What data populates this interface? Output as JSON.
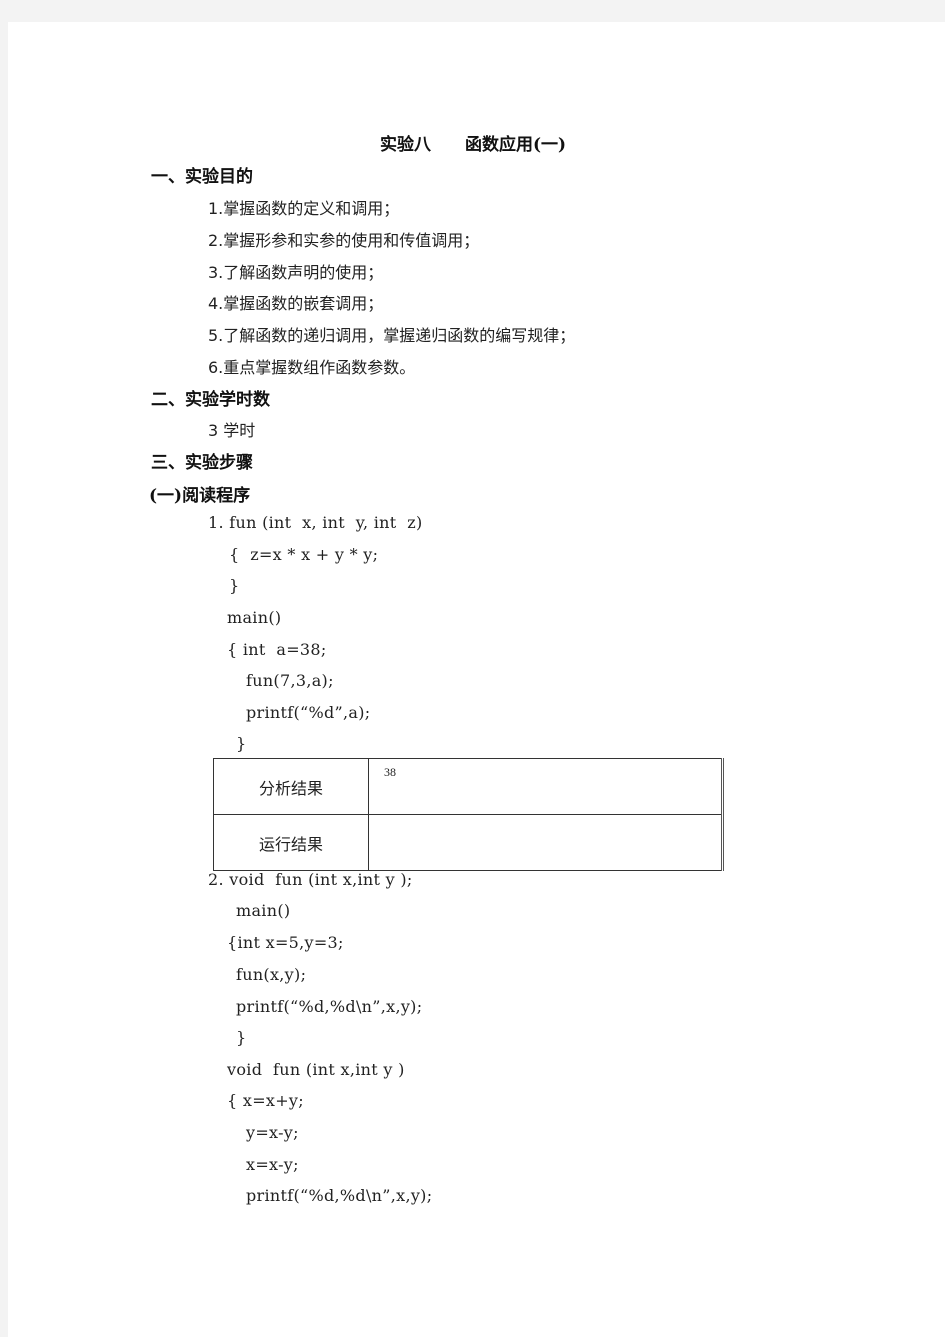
{
  "document": {
    "title": "实验八　　函数应用(一)",
    "sections": {
      "purpose": {
        "heading": "一、实验目的",
        "items": [
          "1.掌握函数的定义和调用；",
          "2.掌握形参和实参的使用和传值调用；",
          "3.了解函数声明的使用；",
          "4.掌握函数的嵌套调用；",
          "5.了解函数的递归调用，掌握递归函数的编写规律；",
          "6.重点掌握数组作函数参数。"
        ]
      },
      "hours": {
        "heading": "二、实验学时数",
        "value": "3 学时"
      },
      "steps": {
        "heading": "三、实验步骤",
        "subheading": "(一)阅读程序"
      }
    },
    "program1": {
      "lines": [
        "1. fun (int  x, int  y, int  z)",
        "{  z=x * x + y * y;",
        "}",
        "main()",
        "{ int  a=38;",
        "fun(7,3,a);",
        "printf(“%d”,a);",
        "}"
      ]
    },
    "result_table": {
      "rows": [
        {
          "label": "分析结果",
          "value": "38"
        },
        {
          "label": "运行结果",
          "value": ""
        }
      ]
    },
    "program2": {
      "lines": [
        "2. void  fun (int x,int y );",
        "main()",
        "{int x=5,y=3;",
        "fun(x,y);",
        "printf(“%d,%d\\n”,x,y);",
        "}",
        "void  fun (int x,int y )",
        "{ x=x+y;",
        "y=x-y;",
        "x=x-y;",
        "printf(“%d,%d\\n”,x,y);"
      ]
    }
  }
}
